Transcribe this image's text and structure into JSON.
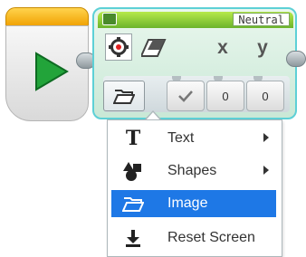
{
  "display_block": {
    "mode_label": "Neutral",
    "params": [
      {
        "icon": "color-sensor-icon"
      },
      {
        "icon": "eraser-icon"
      },
      {
        "label": "x"
      },
      {
        "label": "y"
      }
    ],
    "values": [
      "0",
      "0"
    ]
  },
  "menu": {
    "items": [
      {
        "label": "Text",
        "icon": "text-icon",
        "has_submenu": true,
        "selected": false
      },
      {
        "label": "Shapes",
        "icon": "shapes-icon",
        "has_submenu": true,
        "selected": false
      },
      {
        "label": "Image",
        "icon": "folder-icon",
        "has_submenu": false,
        "selected": true
      },
      {
        "label": "Reset Screen",
        "icon": "download-icon",
        "has_submenu": false,
        "selected": false
      }
    ]
  },
  "colors": {
    "start_tab": "#f0a000",
    "header_green": "#6bb32b",
    "block_outline": "#5dd0d6",
    "selection": "#1e78e6",
    "play": "#22a43a"
  }
}
